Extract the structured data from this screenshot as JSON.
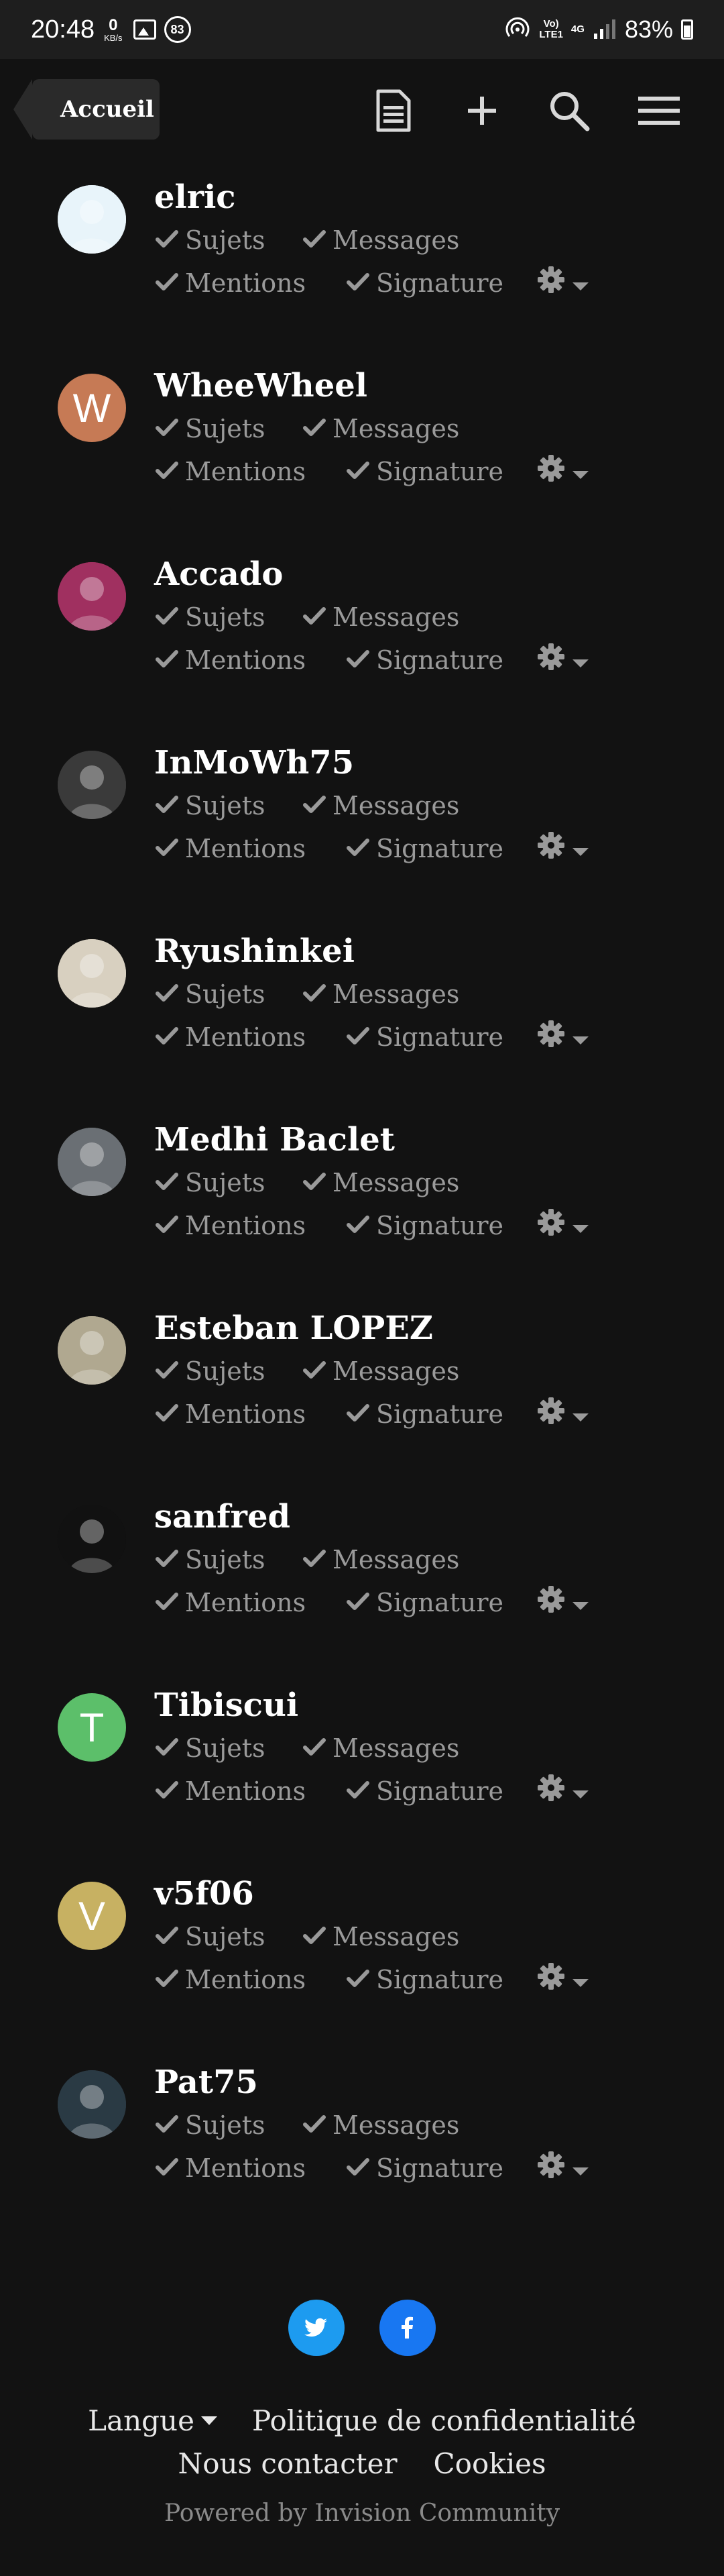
{
  "status": {
    "time": "20:48",
    "kbs_value": "0",
    "kbs_unit": "KB/s",
    "notif_count": "83",
    "lte_top": "Vo)",
    "lte_bottom": "LTE1",
    "net": "4G",
    "battery": "83%"
  },
  "header": {
    "back_label": "Accueil"
  },
  "colors": {
    "accent_twitter": "#1d9bf0",
    "accent_facebook": "#1877f2",
    "background": "#121212"
  },
  "members": [
    {
      "name": "elric",
      "avatar_letter": "",
      "avatar_color": "#e8f4fa",
      "avatar_icon": "cartoon-cat-avatar"
    },
    {
      "name": "WheeWheel",
      "avatar_letter": "W",
      "avatar_color": "#c67a55",
      "avatar_icon": "letter-avatar"
    },
    {
      "name": "Accado",
      "avatar_letter": "",
      "avatar_color": "#a03060",
      "avatar_icon": "photo-avatar"
    },
    {
      "name": "InMoWh75",
      "avatar_letter": "",
      "avatar_color": "#3a3a3a",
      "avatar_icon": "photo-avatar"
    },
    {
      "name": "Ryushinkei",
      "avatar_letter": "",
      "avatar_color": "#d8d0c0",
      "avatar_icon": "photo-avatar"
    },
    {
      "name": "Medhi Baclet",
      "avatar_letter": "",
      "avatar_color": "#6a6f74",
      "avatar_icon": "photo-avatar"
    },
    {
      "name": "Esteban LOPEZ",
      "avatar_letter": "",
      "avatar_color": "#b0a890",
      "avatar_icon": "photo-avatar"
    },
    {
      "name": "sanfred",
      "avatar_letter": "",
      "avatar_color": "#111111",
      "avatar_icon": "photo-avatar"
    },
    {
      "name": "Tibiscui",
      "avatar_letter": "T",
      "avatar_color": "#5cbf6a",
      "avatar_icon": "letter-avatar"
    },
    {
      "name": "v5f06",
      "avatar_letter": "V",
      "avatar_color": "#c7b162",
      "avatar_icon": "letter-avatar"
    },
    {
      "name": "Pat75",
      "avatar_letter": "",
      "avatar_color": "#2a3a44",
      "avatar_icon": "photo-avatar"
    }
  ],
  "labels": {
    "sujets": "Sujets",
    "messages": "Messages",
    "mentions": "Mentions",
    "signature": "Signature"
  },
  "footer": {
    "langue": "Langue",
    "privacy": "Politique de confidentialité",
    "contact": "Nous contacter",
    "cookies": "Cookies",
    "powered": "Powered by Invision Community"
  }
}
